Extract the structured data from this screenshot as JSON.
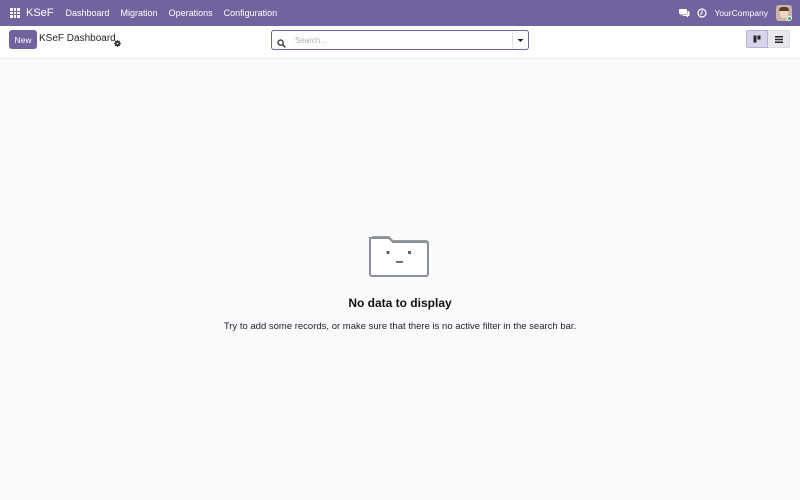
{
  "navbar": {
    "app_name": "KSeF",
    "menu": [
      {
        "label": "Dashboard"
      },
      {
        "label": "Migration"
      },
      {
        "label": "Operations"
      },
      {
        "label": "Configuration"
      }
    ],
    "company": "YourCompany",
    "icons": [
      "apps-icon",
      "chat-icon",
      "clock-icon"
    ],
    "accent_color": "#71639e"
  },
  "control_panel": {
    "new_label": "New",
    "title": "KSeF Dashboard",
    "search": {
      "placeholder": "Search...",
      "value": ""
    },
    "views": [
      "kanban-view",
      "list-view"
    ],
    "active_view": "kanban-view"
  },
  "empty_state": {
    "title": "No data to display",
    "description": "Try to add some records, or make sure that there is no active filter in the search bar."
  }
}
